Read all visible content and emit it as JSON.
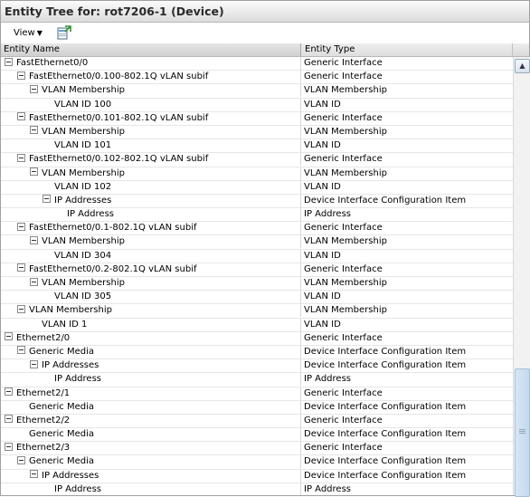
{
  "window": {
    "title": "Entity Tree for: rot7206-1 (Device)"
  },
  "toolbar": {
    "view_label": "View",
    "view_icon": "caret-down-icon",
    "export_icon": "export-icon"
  },
  "columns": {
    "name": "Entity Name",
    "type": "Entity Type"
  },
  "rows": [
    {
      "level": 1,
      "expanded": true,
      "name": "FastEthernet0/0",
      "type": "Generic Interface"
    },
    {
      "level": 2,
      "expanded": true,
      "name": "FastEthernet0/0.100-802.1Q vLAN subif",
      "type": "Generic Interface"
    },
    {
      "level": 3,
      "expanded": true,
      "name": "VLAN Membership",
      "type": "VLAN Membership"
    },
    {
      "level": 4,
      "expanded": false,
      "name": "VLAN ID 100",
      "type": "VLAN ID"
    },
    {
      "level": 2,
      "expanded": true,
      "name": "FastEthernet0/0.101-802.1Q vLAN subif",
      "type": "Generic Interface"
    },
    {
      "level": 3,
      "expanded": true,
      "name": "VLAN Membership",
      "type": "VLAN Membership"
    },
    {
      "level": 4,
      "expanded": false,
      "name": "VLAN ID 101",
      "type": "VLAN ID"
    },
    {
      "level": 2,
      "expanded": true,
      "name": "FastEthernet0/0.102-802.1Q vLAN subif",
      "type": "Generic Interface"
    },
    {
      "level": 3,
      "expanded": true,
      "name": "VLAN Membership",
      "type": "VLAN Membership"
    },
    {
      "level": 4,
      "expanded": false,
      "name": "VLAN ID 102",
      "type": "VLAN ID"
    },
    {
      "level": 4,
      "expanded": true,
      "name": "IP Addresses",
      "type": "Device Interface Configuration Item"
    },
    {
      "level": 5,
      "expanded": false,
      "name": "IP Address",
      "type": "IP Address"
    },
    {
      "level": 2,
      "expanded": true,
      "name": "FastEthernet0/0.1-802.1Q vLAN subif",
      "type": "Generic Interface"
    },
    {
      "level": 3,
      "expanded": true,
      "name": "VLAN Membership",
      "type": "VLAN Membership"
    },
    {
      "level": 4,
      "expanded": false,
      "name": "VLAN ID 304",
      "type": "VLAN ID"
    },
    {
      "level": 2,
      "expanded": true,
      "name": "FastEthernet0/0.2-802.1Q vLAN subif",
      "type": "Generic Interface"
    },
    {
      "level": 3,
      "expanded": true,
      "name": "VLAN Membership",
      "type": "VLAN Membership"
    },
    {
      "level": 4,
      "expanded": false,
      "name": "VLAN ID 305",
      "type": "VLAN ID"
    },
    {
      "level": 2,
      "expanded": true,
      "name": "VLAN Membership",
      "type": "VLAN Membership"
    },
    {
      "level": 3,
      "expanded": false,
      "name": "VLAN ID 1",
      "type": "VLAN ID"
    },
    {
      "level": 1,
      "expanded": true,
      "name": "Ethernet2/0",
      "type": "Generic Interface"
    },
    {
      "level": 2,
      "expanded": true,
      "name": "Generic Media",
      "type": "Device Interface Configuration Item"
    },
    {
      "level": 3,
      "expanded": true,
      "name": "IP Addresses",
      "type": "Device Interface Configuration Item"
    },
    {
      "level": 4,
      "expanded": false,
      "name": "IP Address",
      "type": "IP Address"
    },
    {
      "level": 1,
      "expanded": true,
      "name": "Ethernet2/1",
      "type": "Generic Interface"
    },
    {
      "level": 2,
      "expanded": false,
      "name": "Generic Media",
      "type": "Device Interface Configuration Item"
    },
    {
      "level": 1,
      "expanded": true,
      "name": "Ethernet2/2",
      "type": "Generic Interface"
    },
    {
      "level": 2,
      "expanded": false,
      "name": "Generic Media",
      "type": "Device Interface Configuration Item"
    },
    {
      "level": 1,
      "expanded": true,
      "name": "Ethernet2/3",
      "type": "Generic Interface"
    },
    {
      "level": 2,
      "expanded": true,
      "name": "Generic Media",
      "type": "Device Interface Configuration Item"
    },
    {
      "level": 3,
      "expanded": true,
      "name": "IP Addresses",
      "type": "Device Interface Configuration Item"
    },
    {
      "level": 4,
      "expanded": false,
      "name": "IP Address",
      "type": "IP Address"
    }
  ],
  "scrollbar": {
    "up_icon": "scroll-up-arrow-icon"
  }
}
